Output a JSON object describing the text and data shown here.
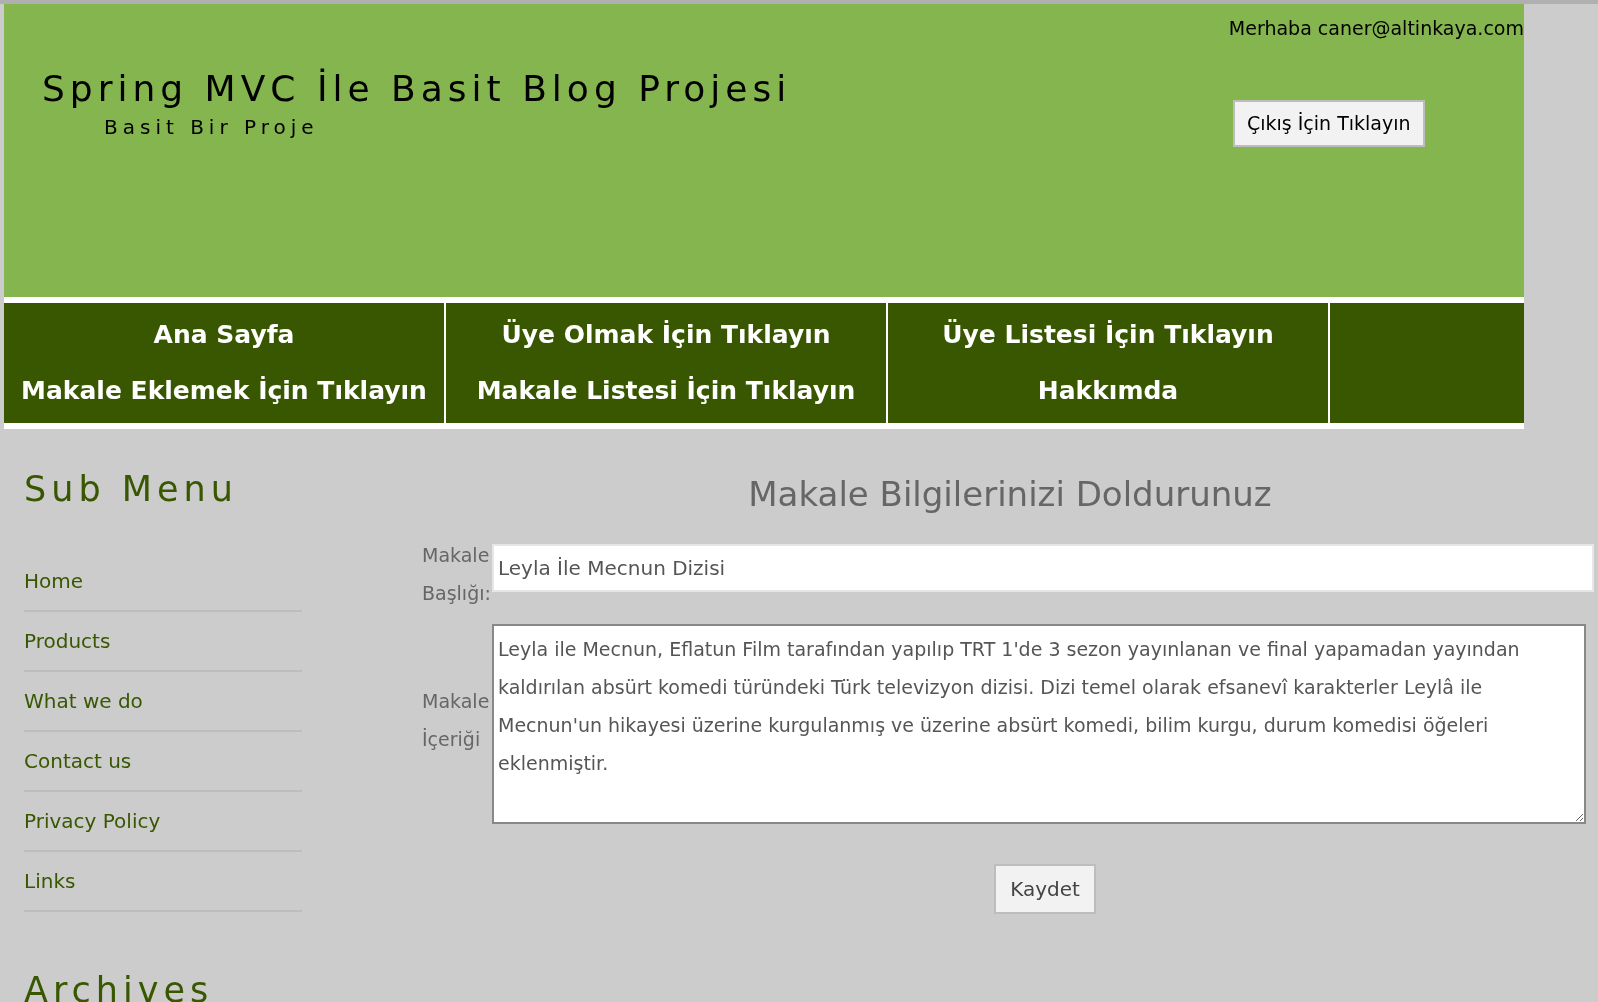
{
  "header": {
    "greeting": "Merhaba caner@altinkaya.com",
    "title": "Spring MVC İle Basit Blog Projesi",
    "subtitle": "Basit Bir Proje",
    "logout_button": "Çıkış İçin Tıklayın"
  },
  "nav": {
    "columns": [
      [
        "Ana Sayfa",
        "Makale Eklemek İçin Tıklayın"
      ],
      [
        "Üye Olmak İçin Tıklayın",
        "Makale Listesi İçin Tıklayın"
      ],
      [
        "Üye Listesi İçin Tıklayın",
        "Hakkımda"
      ]
    ]
  },
  "sidebar": {
    "title": "Sub Menu",
    "items": [
      "Home",
      "Products",
      "What we do",
      "Contact us",
      "Privacy Policy",
      "Links"
    ],
    "archives_title": "Archives"
  },
  "form": {
    "heading": "Makale Bilgilerinizi Doldurunuz",
    "fields": [
      {
        "kind": "input",
        "label": "Makale Başlığı:",
        "value": "Leyla İle Mecnun Dizisi"
      },
      {
        "kind": "textarea",
        "label": "Makale İçeriği",
        "value": "Leyla ile Mecnun, Eflatun Film tarafından yapılıp TRT 1'de 3 sezon yayınlanan ve final yapamadan yayından kaldırılan absürt komedi türündeki Türk televizyon dizisi. Dizi temel olarak efsanevî karakterler Leylâ ile Mecnun'un hikayesi üzerine kurgulanmış ve üzerine absürt komedi, bilim kurgu, durum komedisi öğeleri eklenmiştir."
      }
    ],
    "submit_button": "Kaydet"
  }
}
